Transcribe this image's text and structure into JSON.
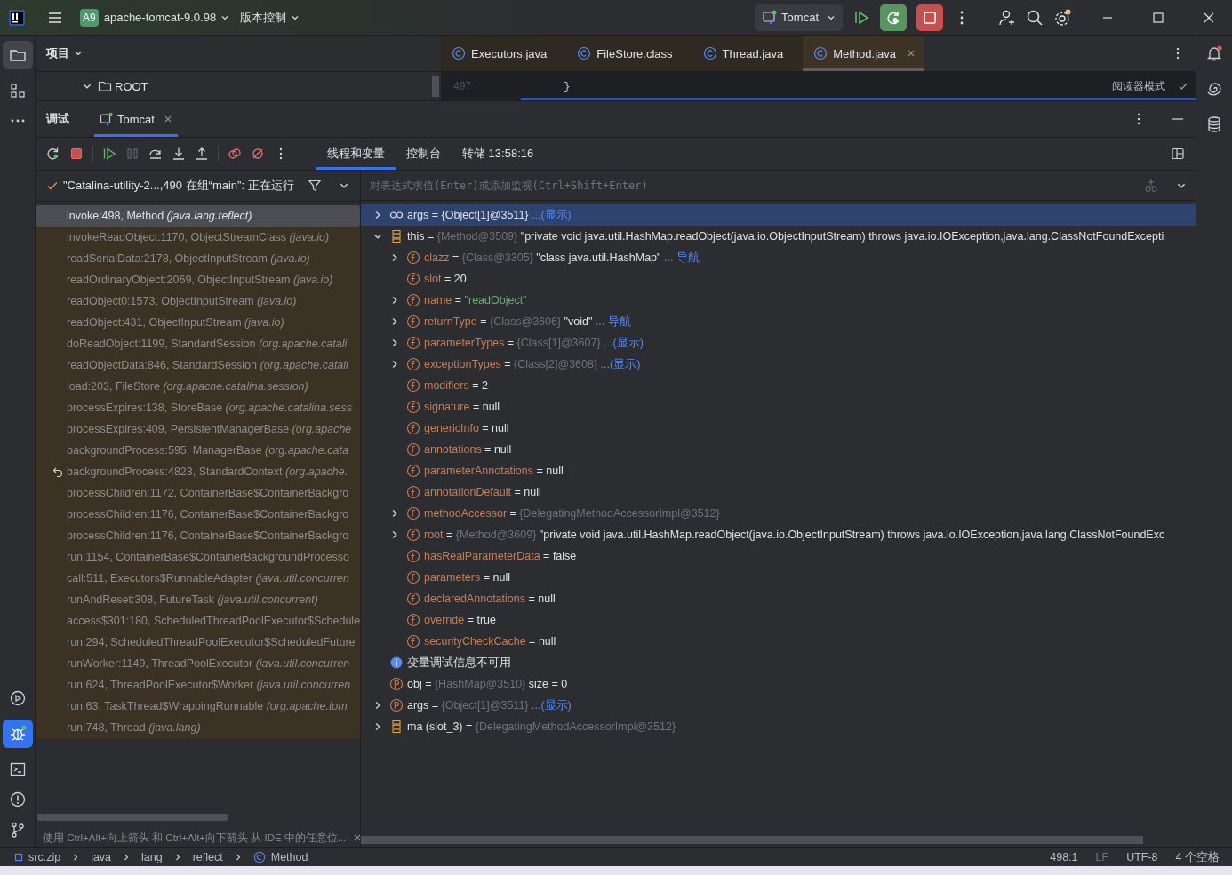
{
  "title_bar": {
    "badge": "A9",
    "project": "apache-tomcat-9.0.98",
    "vcs": "版本控制",
    "run_config": "Tomcat"
  },
  "project_panel": {
    "title": "项目",
    "tree": [
      {
        "label": "ROOT",
        "expanded": true
      }
    ]
  },
  "editor": {
    "tabs": [
      {
        "label": "Executors.java",
        "selected": false,
        "closable": false
      },
      {
        "label": "FileStore.class",
        "selected": false,
        "closable": false
      },
      {
        "label": "Thread.java",
        "selected": false,
        "closable": false
      },
      {
        "label": "Method.java",
        "selected": true,
        "closable": true
      }
    ],
    "line_number": "497",
    "code": "}",
    "reader_mode": "阅读器模式"
  },
  "debug": {
    "title": "调试",
    "session_tabs": [
      {
        "label": "Tomcat",
        "selected": true
      }
    ],
    "view_tabs": [
      {
        "label": "线程和变量",
        "selected": true
      },
      {
        "label": "控制台",
        "selected": false
      },
      {
        "label": "转储 13:58:16",
        "selected": false
      }
    ],
    "thread": "\"Catalina-utility-2...,490 在组“main”: 正在运行",
    "eval_placeholder": "对表达式求值(Enter)或添加监视(Ctrl+Shift+Enter)",
    "frames": [
      {
        "text": "invoke:498, Method",
        "package": "(java.lang.reflect)",
        "selected": true,
        "drop_frame": false
      },
      {
        "text": "invokeReadObject:1170, ObjectStreamClass",
        "package": "(java.io)",
        "selected": false,
        "drop_frame": false
      },
      {
        "text": "readSerialData:2178, ObjectInputStream",
        "package": "(java.io)",
        "selected": false,
        "drop_frame": false
      },
      {
        "text": "readOrdinaryObject:2069, ObjectInputStream",
        "package": "(java.io)",
        "selected": false,
        "drop_frame": false
      },
      {
        "text": "readObject0:1573, ObjectInputStream",
        "package": "(java.io)",
        "selected": false,
        "drop_frame": false
      },
      {
        "text": "readObject:431, ObjectInputStream",
        "package": "(java.io)",
        "selected": false,
        "drop_frame": false
      },
      {
        "text": "doReadObject:1199, StandardSession",
        "package": "(org.apache.catali",
        "selected": false,
        "drop_frame": false
      },
      {
        "text": "readObjectData:846, StandardSession",
        "package": "(org.apache.catali",
        "selected": false,
        "drop_frame": false
      },
      {
        "text": "load:203, FileStore",
        "package": "(org.apache.catalina.session)",
        "selected": false,
        "drop_frame": false
      },
      {
        "text": "processExpires:138, StoreBase",
        "package": "(org.apache.catalina.sess",
        "selected": false,
        "drop_frame": false
      },
      {
        "text": "processExpires:409, PersistentManagerBase",
        "package": "(org.apache",
        "selected": false,
        "drop_frame": false
      },
      {
        "text": "backgroundProcess:595, ManagerBase",
        "package": "(org.apache.cata",
        "selected": false,
        "drop_frame": false
      },
      {
        "text": "backgroundProcess:4823, StandardContext",
        "package": "(org.apache.",
        "selected": false,
        "drop_frame": true
      },
      {
        "text": "processChildren:1172, ContainerBase$ContainerBackgro",
        "selected": false,
        "drop_frame": false
      },
      {
        "text": "processChildren:1176, ContainerBase$ContainerBackgro",
        "selected": false,
        "drop_frame": false
      },
      {
        "text": "processChildren:1176, ContainerBase$ContainerBackgro",
        "selected": false,
        "drop_frame": false
      },
      {
        "text": "run:1154, ContainerBase$ContainerBackgroundProcesso",
        "selected": false,
        "drop_frame": false
      },
      {
        "text": "call:511, Executors$RunnableAdapter",
        "package": "(java.util.concurren",
        "selected": false,
        "drop_frame": false
      },
      {
        "text": "runAndReset:308, FutureTask",
        "package": "(java.util.concurrent)",
        "selected": false,
        "drop_frame": false
      },
      {
        "text": "access$301:180, ScheduledThreadPoolExecutor$Schedule",
        "selected": false,
        "drop_frame": false
      },
      {
        "text": "run:294, ScheduledThreadPoolExecutor$ScheduledFuture",
        "selected": false,
        "drop_frame": false
      },
      {
        "text": "runWorker:1149, ThreadPoolExecutor",
        "package": "(java.util.concurren",
        "selected": false,
        "drop_frame": false
      },
      {
        "text": "run:624, ThreadPoolExecutor$Worker",
        "package": "(java.util.concurren",
        "selected": false,
        "drop_frame": false
      },
      {
        "text": "run:63, TaskThread$WrappingRunnable",
        "package": "(org.apache.tom",
        "selected": false,
        "drop_frame": false
      },
      {
        "text": "run:748, Thread",
        "package": "(java.lang)",
        "selected": false,
        "drop_frame": false
      }
    ],
    "variables": [
      {
        "kind": "watch",
        "expanded": false,
        "selected": true,
        "name": "args",
        "eq": "=",
        "value": "{Object[1]@3511}",
        "link": "...(显示)"
      },
      {
        "kind": "local",
        "expanded": true,
        "selected": false,
        "name": "this",
        "eq": "=",
        "ref": "{Method@3509}",
        "value": "\"private void java.util.HashMap.readObject(java.io.ObjectInputStream) throws java.io.IOException,java.lang.ClassNotFoundExcepti",
        "children": [
          {
            "kind": "field",
            "expanded": false,
            "selected": false,
            "name": "clazz",
            "eq": "=",
            "ref": "{Class@3305}",
            "value": "\"class java.util.HashMap\"",
            "link": "... 导航"
          },
          {
            "kind": "field",
            "selected": false,
            "name": "slot",
            "eq": "=",
            "value": "20"
          },
          {
            "kind": "field",
            "expanded": false,
            "selected": false,
            "name": "name",
            "eq": "=",
            "string_value": "\"readObject\""
          },
          {
            "kind": "field",
            "expanded": false,
            "selected": false,
            "name": "returnType",
            "eq": "=",
            "ref": "{Class@3606}",
            "value": "\"void\"",
            "link": "... 导航"
          },
          {
            "kind": "field",
            "expanded": false,
            "selected": false,
            "name": "parameterTypes",
            "eq": "=",
            "ref": "{Class[1]@3607}",
            "link": "...(显示)"
          },
          {
            "kind": "field",
            "expanded": false,
            "selected": false,
            "name": "exceptionTypes",
            "eq": "=",
            "ref": "{Class[2]@3608}",
            "link": "...(显示)"
          },
          {
            "kind": "field",
            "selected": false,
            "name": "modifiers",
            "eq": "=",
            "value": "2"
          },
          {
            "kind": "field",
            "selected": false,
            "name": "signature",
            "eq": "=",
            "value": "null"
          },
          {
            "kind": "field",
            "selected": false,
            "name": "genericInfo",
            "eq": "=",
            "value": "null"
          },
          {
            "kind": "field",
            "selected": false,
            "name": "annotations",
            "eq": "=",
            "value": "null"
          },
          {
            "kind": "field",
            "selected": false,
            "name": "parameterAnnotations",
            "eq": "=",
            "value": "null"
          },
          {
            "kind": "field",
            "selected": false,
            "name": "annotationDefault",
            "eq": "=",
            "value": "null"
          },
          {
            "kind": "field",
            "expanded": false,
            "selected": false,
            "name": "methodAccessor",
            "eq": "=",
            "ref": "{DelegatingMethodAccessorImpl@3512}"
          },
          {
            "kind": "field",
            "expanded": false,
            "selected": false,
            "name": "root",
            "eq": "=",
            "ref": "{Method@3609}",
            "value": "\"private void java.util.HashMap.readObject(java.io.ObjectInputStream) throws java.io.IOException,java.lang.ClassNotFoundExc"
          },
          {
            "kind": "field",
            "selected": false,
            "name": "hasRealParameterData",
            "eq": "=",
            "value": "false"
          },
          {
            "kind": "field",
            "selected": false,
            "name": "parameters",
            "eq": "=",
            "value": "null"
          },
          {
            "kind": "field",
            "selected": false,
            "name": "declaredAnnotations",
            "eq": "=",
            "value": "null"
          },
          {
            "kind": "field",
            "selected": false,
            "name": "override",
            "eq": "=",
            "value": "true"
          },
          {
            "kind": "field",
            "selected": false,
            "name": "securityCheckCache",
            "eq": "=",
            "value": "null"
          }
        ]
      },
      {
        "kind": "info",
        "selected": false,
        "name": "变量调试信息不可用"
      },
      {
        "kind": "param",
        "selected": false,
        "name": "obj",
        "eq": "=",
        "ref": "{HashMap@3510}",
        "value": "size = 0"
      },
      {
        "kind": "param",
        "expanded": false,
        "selected": false,
        "name": "args",
        "eq": "=",
        "ref": "{Object[1]@3511}",
        "link": "...(显示)"
      },
      {
        "kind": "local",
        "expanded": false,
        "selected": false,
        "name": "ma (slot_3)",
        "eq": "=",
        "ref": "{DelegatingMethodAccessorImpl@3512}"
      }
    ],
    "hint": "使用 Ctrl+Alt+向上箭头 和 Ctrl+Alt+向下箭头 从 IDE 中的任意位..."
  },
  "breadcrumbs": [
    "src.zip",
    "java",
    "lang",
    "reflect",
    "Method"
  ],
  "status_bar": {
    "position": "498:1",
    "line_ending": "LF",
    "encoding": "UTF-8",
    "indent": "4 个空格"
  }
}
